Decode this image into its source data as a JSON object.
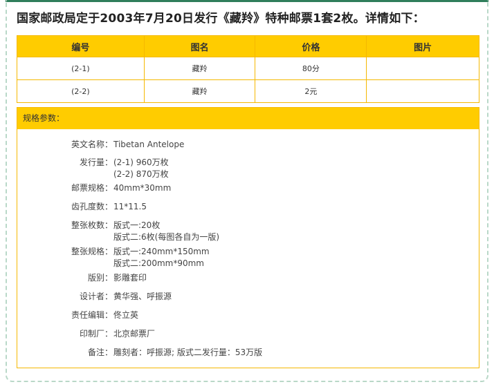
{
  "headline": "国家邮政局定于2003年7月20日发行《藏羚》特种邮票1套2枚。详情如下：",
  "table": {
    "headers": [
      "编号",
      "图名",
      "价格",
      "图片"
    ],
    "rows": [
      [
        "(2-1)",
        "藏羚",
        "80分",
        ""
      ],
      [
        "(2-2)",
        "藏羚",
        "2元",
        ""
      ]
    ]
  },
  "spec": {
    "title": "规格参数：",
    "items": [
      {
        "label": "英文名称：",
        "lines": [
          "Tibetan Antelope"
        ]
      },
      {
        "label": "发行量：",
        "lines": [
          "(2-1) 960万枚",
          "(2-2) 870万枚"
        ]
      },
      {
        "label": "邮票规格：",
        "lines": [
          "40mm*30mm"
        ]
      },
      {
        "label": "齿孔度数：",
        "lines": [
          "11*11.5"
        ]
      },
      {
        "label": "整张枚数：",
        "lines": [
          "版式一:20枚",
          "版式二:6枚(每图各自为一版)"
        ]
      },
      {
        "label": "整张规格：",
        "lines": [
          "版式一:240mm*150mm",
          "版式二:200mm*90mm"
        ]
      },
      {
        "label": "版别：",
        "lines": [
          "影雕套印"
        ]
      },
      {
        "label": "设计者：",
        "lines": [
          "黄华强、呼振源"
        ]
      },
      {
        "label": "责任编辑：",
        "lines": [
          "佟立英"
        ]
      },
      {
        "label": "印制厂：",
        "lines": [
          "北京邮票厂"
        ]
      },
      {
        "label": "备注：",
        "lines": [
          "雕刻者：呼振源; 版式二发行量：53万版"
        ]
      }
    ]
  },
  "colors": {
    "accent": "#ffcc00",
    "border": "#f5b800",
    "topbar": "#2f7e5b"
  }
}
